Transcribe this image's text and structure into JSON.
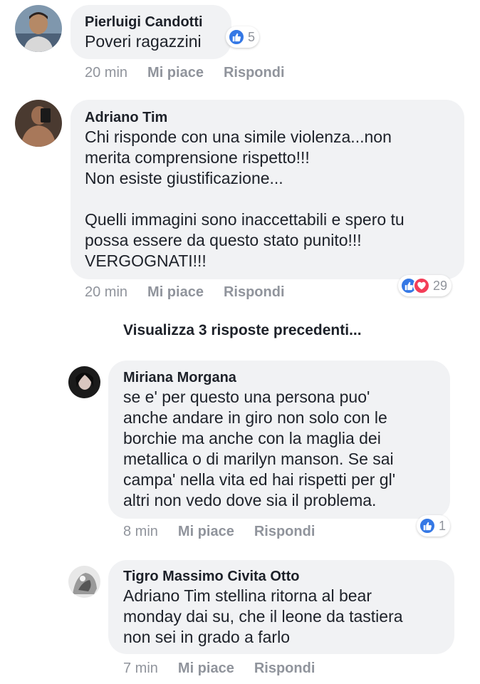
{
  "comments": [
    {
      "author": "Pierluigi Candotti",
      "lines": [
        "Poveri ragazzini"
      ],
      "time": "20 min",
      "like_label": "Mi piace",
      "reply_label": "Rispondi",
      "reactions": {
        "types": [
          "like"
        ],
        "count": "5"
      }
    },
    {
      "author": "Adriano Tim",
      "lines": [
        "Chi risponde con una simile violenza...non",
        "merita comprensione rispetto!!!",
        "Non esiste giustificazione...",
        "",
        "Quelli immagini sono inaccettabili e spero tu",
        "possa essere da questo stato punito!!!",
        "VERGOGNATI!!!"
      ],
      "time": "20 min",
      "like_label": "Mi piace",
      "reply_label": "Rispondi",
      "reactions": {
        "types": [
          "like",
          "love"
        ],
        "count": "29"
      }
    }
  ],
  "view_previous_replies": "Visualizza 3 risposte precedenti...",
  "replies": [
    {
      "author": "Miriana Morgana",
      "lines": [
        "se e' per questo una persona puo'",
        "anche andare in giro non solo con le",
        "borchie ma anche con la maglia dei",
        "metallica o di marilyn manson. Se sai",
        "campa' nella vita ed hai rispetti per gl'",
        "altri non vedo dove sia il problema."
      ],
      "time": "8 min",
      "like_label": "Mi piace",
      "reply_label": "Rispondi",
      "reactions": {
        "types": [
          "like"
        ],
        "count": "1"
      }
    },
    {
      "author": "Tigro Massimo Civita Otto",
      "lines": [
        "Adriano Tim stellina ritorna al bear",
        "monday dai su, che il leone da tastiera",
        "non sei in grado a farlo"
      ],
      "time": "7 min",
      "like_label": "Mi piace",
      "reply_label": "Rispondi"
    }
  ],
  "colors": {
    "bubble": "#f1f2f4",
    "like": "#3578e5",
    "love": "#f33e58",
    "meta": "#90949c"
  },
  "icons": {
    "like": "thumbs-up-icon",
    "love": "heart-icon"
  }
}
